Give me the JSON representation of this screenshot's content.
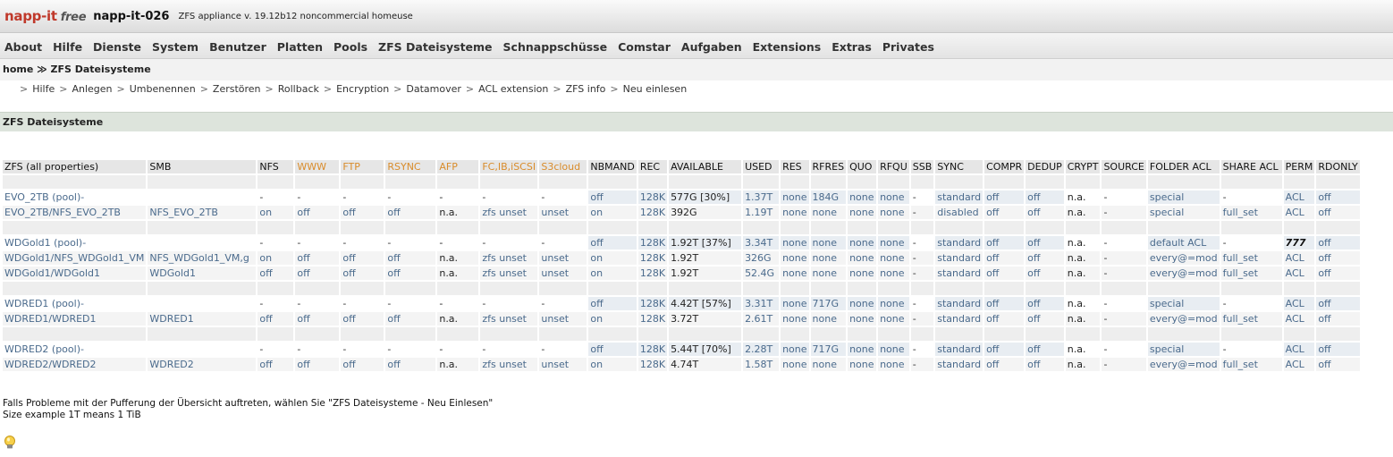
{
  "header": {
    "logo_main": "napp-it",
    "logo_free": "free",
    "hostname": "napp-it-026",
    "version": "ZFS appliance v. 19.12b12 noncommercial homeuse"
  },
  "menu": [
    "About",
    "Hilfe",
    "Dienste",
    "System",
    "Benutzer",
    "Platten",
    "Pools",
    "ZFS Dateisysteme",
    "Schnappschüsse",
    "Comstar",
    "Aufgaben",
    "Extensions",
    "Extras",
    "Privates"
  ],
  "breadcrumb": "home ≫ ZFS Dateisysteme",
  "submenu": [
    "Hilfe",
    "Anlegen",
    "Umbenennen",
    "Zerstören",
    "Rollback",
    "Encryption",
    "Datamover",
    "ACL extension",
    "ZFS info",
    "Neu einlesen"
  ],
  "section_title": "ZFS Dateisysteme",
  "table": {
    "headers": [
      "ZFS (all properties)",
      "SMB",
      "NFS",
      "WWW",
      "FTP",
      "RSYNC",
      "AFP",
      "FC,IB,iSCSI",
      "S3cloud",
      "NBMAND",
      "REC",
      "AVAILABLE",
      "USED",
      "RES",
      "RFRES",
      "QUO",
      "RFQU",
      "SSB",
      "SYNC",
      "COMPR",
      "DEDUP",
      "CRYPT",
      "SOURCE",
      "FOLDER ACL",
      "SHARE ACL",
      "PERM",
      "RDONLY"
    ],
    "orange_headers": [
      "WWW",
      "FTP",
      "RSYNC",
      "AFP",
      "FC,IB,iSCSI",
      "S3cloud"
    ],
    "rows": [
      {
        "type": "spacer"
      },
      {
        "type": "pool",
        "cells": [
          "EVO_2TB (pool)-",
          "",
          "-",
          "-",
          "-",
          "-",
          "-",
          "-",
          "-",
          "off",
          "128K",
          "577G [30%]",
          "1.37T",
          "none",
          "184G",
          "none",
          "none",
          "-",
          "standard",
          "off",
          "off",
          "n.a.",
          "-",
          "special",
          "-",
          "ACL",
          "off"
        ]
      },
      {
        "type": "fs",
        "cells": [
          "EVO_2TB/NFS_EVO_2TB",
          "NFS_EVO_2TB",
          "on",
          "off",
          "off",
          "off",
          "n.a.",
          "zfs unset",
          "unset",
          "on",
          "128K",
          "392G",
          "1.19T",
          "none",
          "none",
          "none",
          "none",
          "-",
          "disabled",
          "off",
          "off",
          "n.a.",
          "-",
          "special",
          "full_set",
          "ACL",
          "off"
        ]
      },
      {
        "type": "spacer"
      },
      {
        "type": "pool",
        "cells": [
          "WDGold1 (pool)-",
          "",
          "-",
          "-",
          "-",
          "-",
          "-",
          "-",
          "-",
          "off",
          "128K",
          "1.92T [37%]",
          "3.34T",
          "none",
          "none",
          "none",
          "none",
          "-",
          "standard",
          "off",
          "off",
          "n.a.",
          "-",
          "default ACL",
          "-",
          "777",
          "off"
        ]
      },
      {
        "type": "fs",
        "cells": [
          "WDGold1/NFS_WDGold1_VM",
          "NFS_WDGold1_VM,g",
          "on",
          "off",
          "off",
          "off",
          "n.a.",
          "zfs unset",
          "unset",
          "on",
          "128K",
          "1.92T",
          "326G",
          "none",
          "none",
          "none",
          "none",
          "-",
          "standard",
          "off",
          "off",
          "n.a.",
          "-",
          "every@=mod",
          "full_set",
          "ACL",
          "off"
        ]
      },
      {
        "type": "fs",
        "cells": [
          "WDGold1/WDGold1",
          "WDGold1",
          "off",
          "off",
          "off",
          "off",
          "n.a.",
          "zfs unset",
          "unset",
          "on",
          "128K",
          "1.92T",
          "52.4G",
          "none",
          "none",
          "none",
          "none",
          "-",
          "standard",
          "off",
          "off",
          "n.a.",
          "-",
          "every@=mod",
          "full_set",
          "ACL",
          "off"
        ]
      },
      {
        "type": "spacer"
      },
      {
        "type": "pool",
        "cells": [
          "WDRED1 (pool)-",
          "",
          "-",
          "-",
          "-",
          "-",
          "-",
          "-",
          "-",
          "off",
          "128K",
          "4.42T [57%]",
          "3.31T",
          "none",
          "717G",
          "none",
          "none",
          "-",
          "standard",
          "off",
          "off",
          "n.a.",
          "-",
          "special",
          "-",
          "ACL",
          "off"
        ]
      },
      {
        "type": "fs",
        "cells": [
          "WDRED1/WDRED1",
          "WDRED1",
          "off",
          "off",
          "off",
          "off",
          "n.a.",
          "zfs unset",
          "unset",
          "on",
          "128K",
          "3.72T",
          "2.61T",
          "none",
          "none",
          "none",
          "none",
          "-",
          "standard",
          "off",
          "off",
          "n.a.",
          "-",
          "every@=mod",
          "full_set",
          "ACL",
          "off"
        ]
      },
      {
        "type": "spacer"
      },
      {
        "type": "pool",
        "cells": [
          "WDRED2 (pool)-",
          "",
          "-",
          "-",
          "-",
          "-",
          "-",
          "-",
          "-",
          "off",
          "128K",
          "5.44T [70%]",
          "2.28T",
          "none",
          "717G",
          "none",
          "none",
          "-",
          "standard",
          "off",
          "off",
          "n.a.",
          "-",
          "special",
          "-",
          "ACL",
          "off"
        ]
      },
      {
        "type": "fs",
        "cells": [
          "WDRED2/WDRED2",
          "WDRED2",
          "off",
          "off",
          "off",
          "off",
          "n.a.",
          "zfs unset",
          "unset",
          "on",
          "128K",
          "4.74T",
          "1.58T",
          "none",
          "none",
          "none",
          "none",
          "-",
          "standard",
          "off",
          "off",
          "n.a.",
          "-",
          "every@=mod",
          "full_set",
          "ACL",
          "off"
        ]
      }
    ]
  },
  "footer": {
    "line1": "Falls Probleme mit der Pufferung der Übersicht auftreten, wählen Sie \"ZFS Dateisysteme - Neu Einlesen\"",
    "line2": "Size example 1T means 1 TiB"
  },
  "colors": {
    "link": "#4a6a8c",
    "orange": "#d98c2b",
    "section_bg": "#dde4dc",
    "logo": "#c0392b"
  },
  "icons": {
    "bulb": "lightbulb-icon"
  }
}
